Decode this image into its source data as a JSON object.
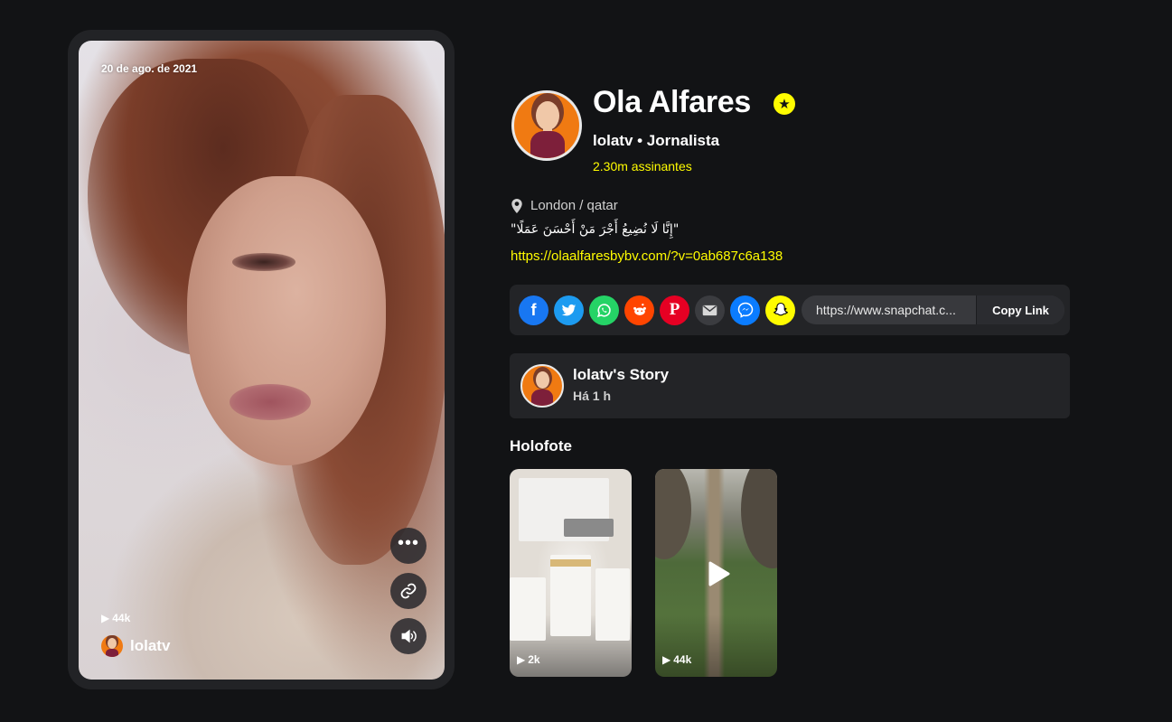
{
  "phone": {
    "date": "20 de ago. de 2021",
    "views": "44k",
    "username": "lolatv",
    "more_icon": "more-icon",
    "link_icon": "link-icon",
    "sound_icon": "sound-icon"
  },
  "profile": {
    "name": "Ola Alfares",
    "verified_icon": "star-badge-icon",
    "subtitle": "lolatv • Jornalista",
    "subscribers": "2.30m assinantes",
    "location": "London / qatar",
    "quote": "\"إِنَّا لَا نُضِيعُ أَجْرَ مَنْ أَحْسَنَ عَمَلًا\"",
    "website": "https://olaalfaresbybv.com/?v=0ab687c6a138"
  },
  "share": {
    "icons": [
      "facebook-icon",
      "twitter-icon",
      "whatsapp-icon",
      "reddit-icon",
      "pinterest-icon",
      "email-icon",
      "messenger-icon",
      "snapchat-icon"
    ],
    "link": "https://www.snapchat.c...",
    "copy_label": "Copy Link"
  },
  "story": {
    "title": "lolatv's Story",
    "time": "Há 1 h"
  },
  "spotlight": {
    "title": "Holofote",
    "items": [
      {
        "views": "2k"
      },
      {
        "views": "44k"
      }
    ]
  },
  "colors": {
    "background": "#121315",
    "accent_yellow": "#fffc00",
    "card": "#232427"
  }
}
